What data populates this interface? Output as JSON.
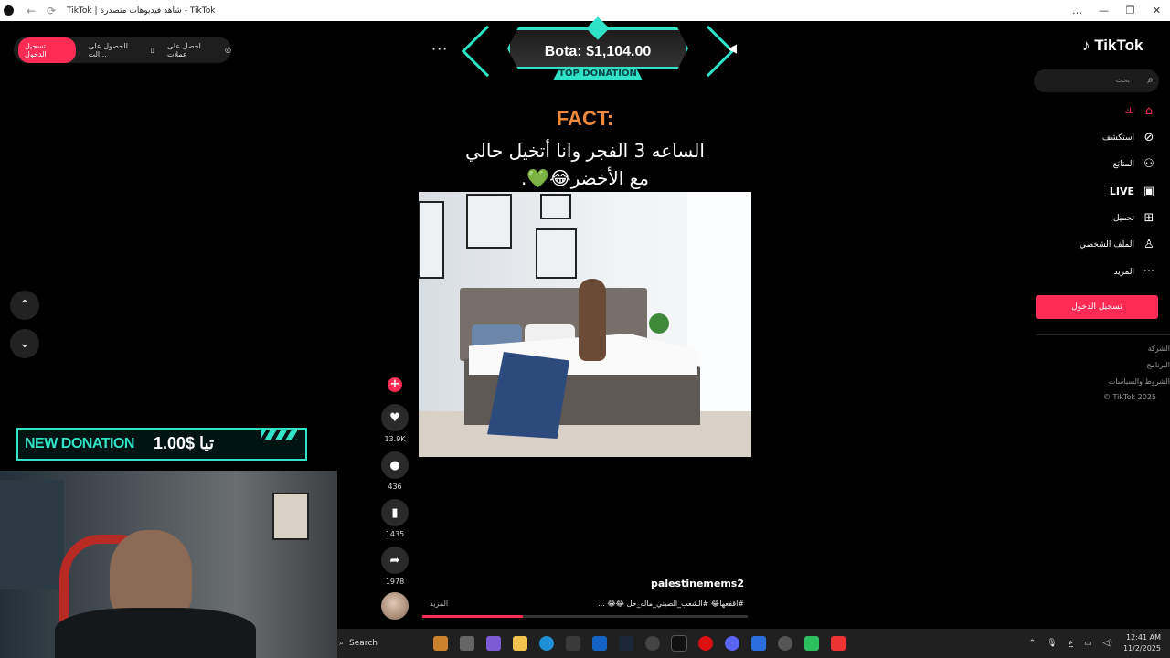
{
  "window": {
    "title": "TikTok | شاهد فيديوهات متصدرة - TikTok",
    "controls": [
      "…",
      "—",
      "❐",
      "✕"
    ]
  },
  "topbar": {
    "login_label": "تسجيل الدخول",
    "get_app_label": "الحصول على الت...",
    "coins_label": "احصل على عملات"
  },
  "overlay_top": {
    "amount": "Bota: $1,104.00",
    "tag": "TOP DONATION"
  },
  "video": {
    "fact_label": "FACT:",
    "caption_line1": "الساعه 3 الفجر وانا أتخيل حالي",
    "caption_line2": "مع الأخضر😂💚.",
    "author": "palestinemems2",
    "hashtags": "#اقفعها😂 #الشعب_الصيني_ماله_حل 😂😂 ...",
    "more_label": "المزيد",
    "progress": 0.31
  },
  "actions": {
    "likes": "13.9K",
    "comments": "436",
    "saves": "1435",
    "shares": "1978"
  },
  "sidebar": {
    "logo": "TikTok",
    "search_placeholder": "بحث",
    "items": [
      {
        "label": "لك",
        "icon": "home-icon",
        "active": true
      },
      {
        "label": "استكشف",
        "icon": "compass-icon"
      },
      {
        "label": "المتابَع",
        "icon": "following-icon"
      },
      {
        "label": "LIVE",
        "icon": "live-icon"
      },
      {
        "label": "تحميل",
        "icon": "upload-icon"
      },
      {
        "label": "الملف الشخصي",
        "icon": "profile-icon"
      },
      {
        "label": "المزيد",
        "icon": "more-icon"
      }
    ],
    "login_button": "تسجيل الدخول",
    "footer": [
      "الشركة",
      "البرنامج",
      "الشروط والسياسات",
      "© TikTok 2025"
    ]
  },
  "overlay_newdonation": {
    "label": "NEW DONATION",
    "value": "1.00$ تيا"
  },
  "taskbar": {
    "search_label": "Search",
    "language": "ع",
    "time": "12:41 AM",
    "date": "11/2/2025"
  },
  "colors": {
    "accent": "#fe2c55",
    "overlay_teal": "#30e3c8"
  }
}
